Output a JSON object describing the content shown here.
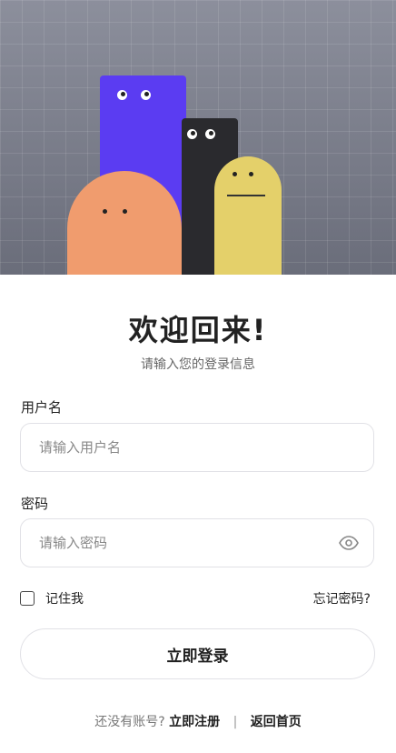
{
  "hero": {
    "illustration": "four-cartoon-characters"
  },
  "header": {
    "title": "欢迎回来!",
    "subtitle": "请输入您的登录信息"
  },
  "form": {
    "username": {
      "label": "用户名",
      "placeholder": "请输入用户名",
      "value": ""
    },
    "password": {
      "label": "密码",
      "placeholder": "请输入密码",
      "value": "",
      "toggle_icon": "eye-icon"
    },
    "remember_label": "记住我",
    "remember_checked": false,
    "forgot_label": "忘记密码?",
    "submit_label": "立即登录"
  },
  "footer": {
    "prompt": "还没有账号?",
    "register_label": "立即注册",
    "separator": "|",
    "home_label": "返回首页"
  },
  "colors": {
    "purple": "#5b3cf2",
    "black": "#2a2a2e",
    "yellow": "#e4d06a",
    "orange": "#f09c6e",
    "hero_bg": "#7b7e8b"
  }
}
